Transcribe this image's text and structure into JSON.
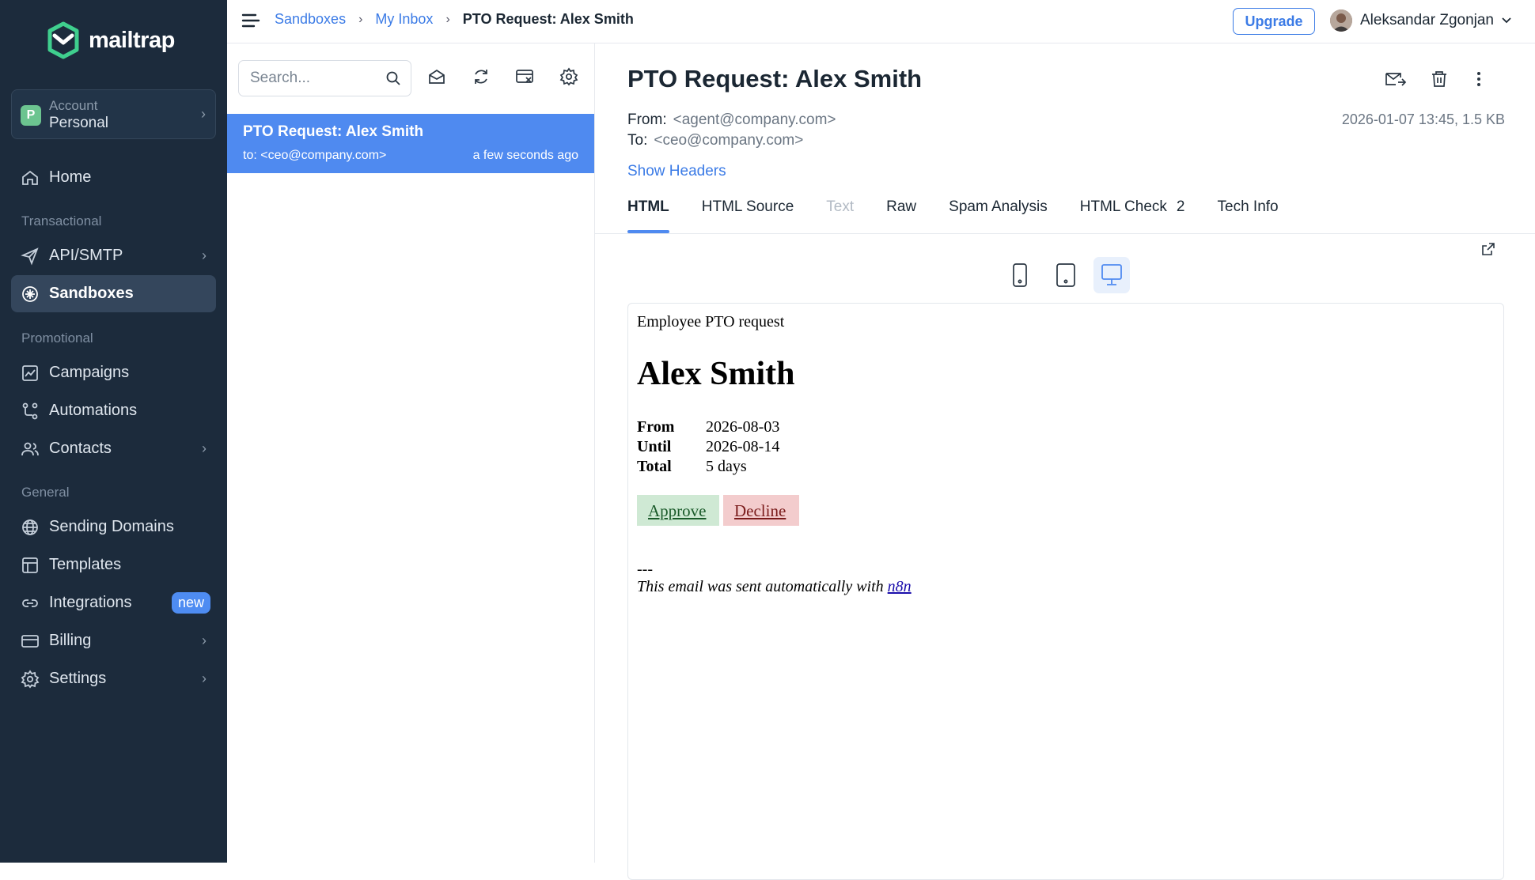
{
  "app": {
    "logo_text": "mailtrap"
  },
  "account": {
    "avatar_letter": "P",
    "label": "Account",
    "name": "Personal"
  },
  "nav": {
    "home": "Home",
    "section_transactional": "Transactional",
    "api_smtp": "API/SMTP",
    "sandboxes": "Sandboxes",
    "section_promotional": "Promotional",
    "campaigns": "Campaigns",
    "automations": "Automations",
    "contacts": "Contacts",
    "section_general": "General",
    "sending_domains": "Sending Domains",
    "templates": "Templates",
    "integrations": "Integrations",
    "integrations_badge": "new",
    "billing": "Billing",
    "settings": "Settings"
  },
  "breadcrumb": {
    "level1": "Sandboxes",
    "level2": "My Inbox",
    "current": "PTO Request: Alex Smith",
    "separator": "›"
  },
  "topbar": {
    "upgrade_label": "Upgrade",
    "user_name": "Aleksandar Zgonjan"
  },
  "search": {
    "placeholder": "Search..."
  },
  "messages": [
    {
      "subject": "PTO Request: Alex Smith",
      "to": "to: <ceo@company.com>",
      "time": "a few seconds ago"
    }
  ],
  "email": {
    "subject": "PTO Request: Alex Smith",
    "from_label": "From:",
    "from": "<agent@company.com>",
    "to_label": "To:",
    "to": "<ceo@company.com>",
    "meta": "2026-01-07 13:45, 1.5 KB",
    "show_headers": "Show Headers"
  },
  "tabs": [
    {
      "label": "HTML"
    },
    {
      "label": "HTML Source"
    },
    {
      "label": "Text"
    },
    {
      "label": "Raw"
    },
    {
      "label": "Spam Analysis"
    },
    {
      "label": "HTML Check",
      "badge": "2"
    },
    {
      "label": "Tech Info"
    }
  ],
  "preview": {
    "intro": "Employee PTO request",
    "name": "Alex Smith",
    "rows": [
      {
        "key": "From",
        "value": "2026-08-03"
      },
      {
        "key": "Until",
        "value": "2026-08-14"
      },
      {
        "key": "Total",
        "value": "5 days"
      }
    ],
    "approve": "Approve",
    "decline": "Decline",
    "separator": "---",
    "footer_text": "This email was sent automatically with",
    "footer_link": "n8n"
  },
  "colors": {
    "sidebar_bg": "#1c2b3c",
    "accent": "#4f8af0",
    "approve_bg": "#cfe9d4",
    "decline_bg": "#f3cccd"
  }
}
